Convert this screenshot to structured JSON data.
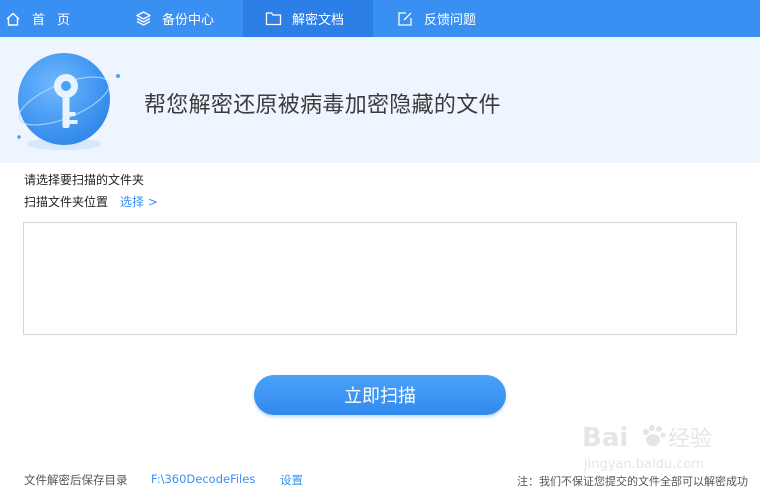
{
  "nav": {
    "tabs": [
      {
        "label": "首页",
        "icon": "home-icon",
        "active": false
      },
      {
        "label": "备份中心",
        "icon": "layers-icon",
        "active": false
      },
      {
        "label": "解密文档",
        "icon": "folder-icon",
        "active": true
      },
      {
        "label": "反馈问题",
        "icon": "edit-icon",
        "active": false
      }
    ]
  },
  "banner": {
    "title": "帮您解密还原被病毒加密隐藏的文件",
    "emblem_icon": "key-icon"
  },
  "main": {
    "select_prompt": "请选择要扫描的文件夹",
    "location_label": "扫描文件夹位置",
    "choose_link": "选择 >",
    "folder_list_value": "",
    "scan_button": "立即扫描"
  },
  "footer": {
    "save_dir_label": "文件解密后保存目录",
    "save_dir_path": "F:\\360DecodeFiles",
    "settings_link": "设置",
    "note": "注：我们不保证您提交的文件全部可以解密成功"
  },
  "watermark": {
    "brand_text": "Bai",
    "brand_text_2": "经验",
    "url_text": "jingyan.baidu.com"
  },
  "colors": {
    "nav_bg": "#3a8ff2",
    "nav_active_bg": "#2b7fe6",
    "banner_bg": "#eef5fe",
    "accent": "#3a8ff2"
  }
}
